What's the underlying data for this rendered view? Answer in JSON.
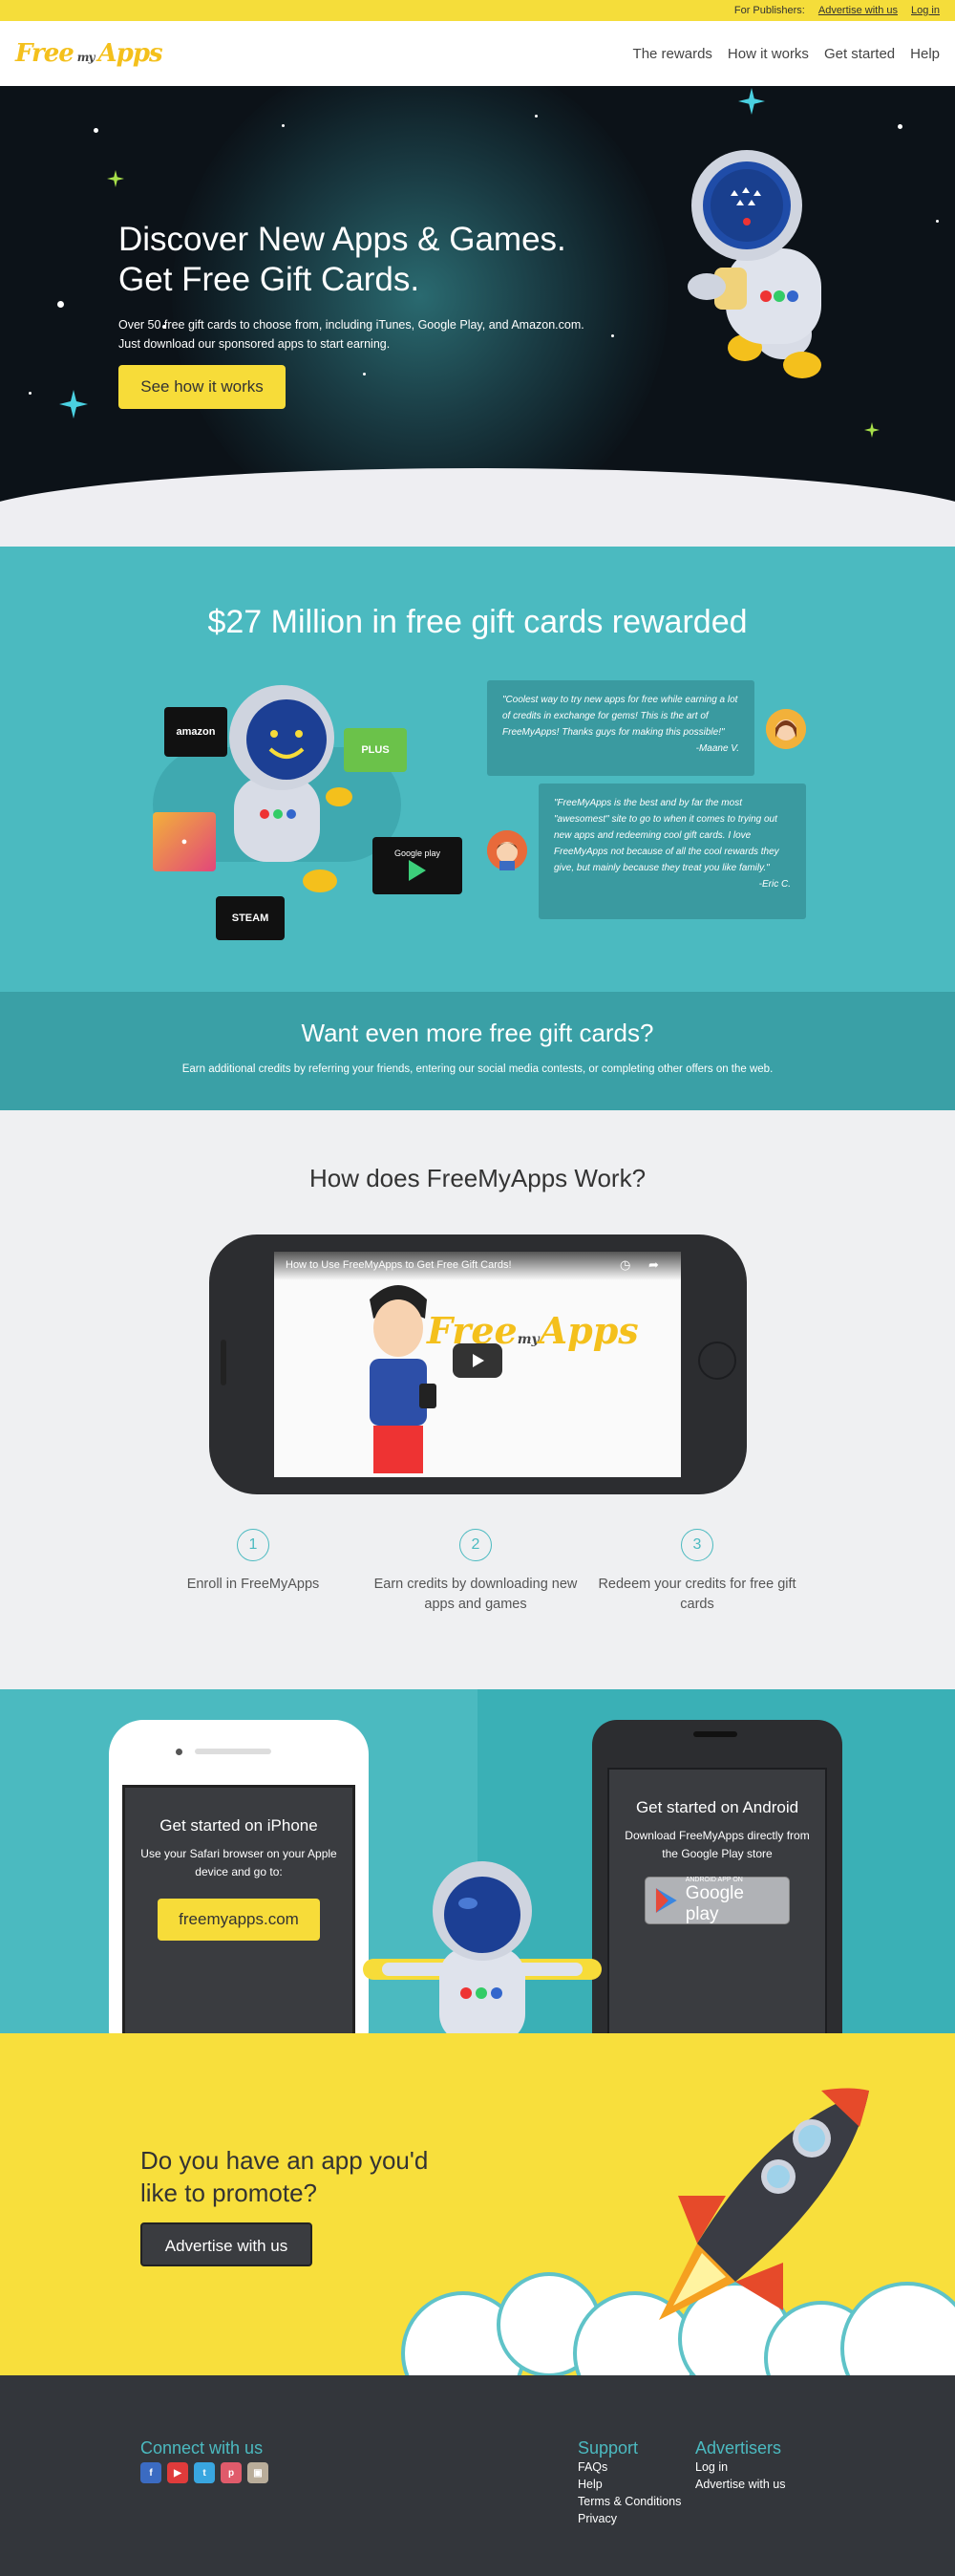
{
  "topbar": {
    "publishers_label": "For Publishers:",
    "advertise_link": "Advertise with us",
    "login_link": "Log in"
  },
  "nav": {
    "logo_main": "Free",
    "logo_my": "my",
    "logo_apps": "Apps",
    "items": [
      "The rewards",
      "How it works",
      "Get started",
      "Help"
    ]
  },
  "hero": {
    "title_line1": "Discover New Apps & Games.",
    "title_line2": "Get Free Gift Cards.",
    "description": "Over 50 free gift cards to choose from, including iTunes, Google Play, and Amazon.com. Just download our sponsored apps to start earning.",
    "cta": "See how it works"
  },
  "rewards": {
    "headline": "$27 Million in free gift cards rewarded",
    "cards": [
      "amazon",
      "PLUS",
      "Google play",
      "STEAM"
    ],
    "testimonials": [
      {
        "text": "\"Coolest way to try new apps for free while earning a lot of credits in exchange for gems! This is the art of FreeMyApps! Thanks guys for making this possible!\"",
        "author": "-Maane V."
      },
      {
        "text": "\"FreeMyApps is the best and by far the most \"awesomest\" site to go to when it comes to trying out new apps and redeeming cool gift cards. I love FreeMyApps not because of all the cool rewards they give, but mainly because they treat you like family.\"",
        "author": "-Eric C."
      }
    ]
  },
  "more": {
    "title": "Want even more free gift cards?",
    "text": "Earn additional credits by referring your friends, entering our social media contests, or completing other offers on the web."
  },
  "how": {
    "title": "How does FreeMyApps Work?",
    "video_title": "How to Use FreeMyApps to Get Free Gift Cards!",
    "steps": [
      {
        "number": "1",
        "text": "Enroll in FreeMyApps"
      },
      {
        "number": "2",
        "text": "Earn credits by downloading new apps and games"
      },
      {
        "number": "3",
        "text": "Redeem your credits for free gift cards"
      }
    ]
  },
  "get_started": {
    "iphone": {
      "title": "Get started on iPhone",
      "text": "Use your Safari browser on your Apple device and go to:",
      "button": "freemyapps.com"
    },
    "android": {
      "title": "Get started on Android",
      "text": "Download FreeMyApps directly from the Google Play store",
      "badge_small": "ANDROID APP ON",
      "badge_big": "Google play"
    }
  },
  "promote": {
    "title": "Do you have an app you'd like to promote?",
    "button": "Advertise with us"
  },
  "footer": {
    "connect_title": "Connect with us",
    "social": [
      {
        "icon": "facebook-icon",
        "glyph": "f",
        "color": "#3b6bc2"
      },
      {
        "icon": "youtube-icon",
        "glyph": "▶",
        "color": "#e03b3b"
      },
      {
        "icon": "twitter-icon",
        "glyph": "t",
        "color": "#39a6e0"
      },
      {
        "icon": "pinterest-icon",
        "glyph": "p",
        "color": "#e05b6b"
      },
      {
        "icon": "instagram-icon",
        "glyph": "▣",
        "color": "#b9ad9a"
      }
    ],
    "support_title": "Support",
    "support_links": [
      "FAQs",
      "Help",
      "Terms & Conditions",
      "Privacy"
    ],
    "advertisers_title": "Advertisers",
    "advertisers_links": [
      "Log in",
      "Advertise with us"
    ]
  },
  "colors": {
    "yellow": "#f7dc39",
    "teal": "#4bbac0",
    "dark": "#33363b"
  }
}
